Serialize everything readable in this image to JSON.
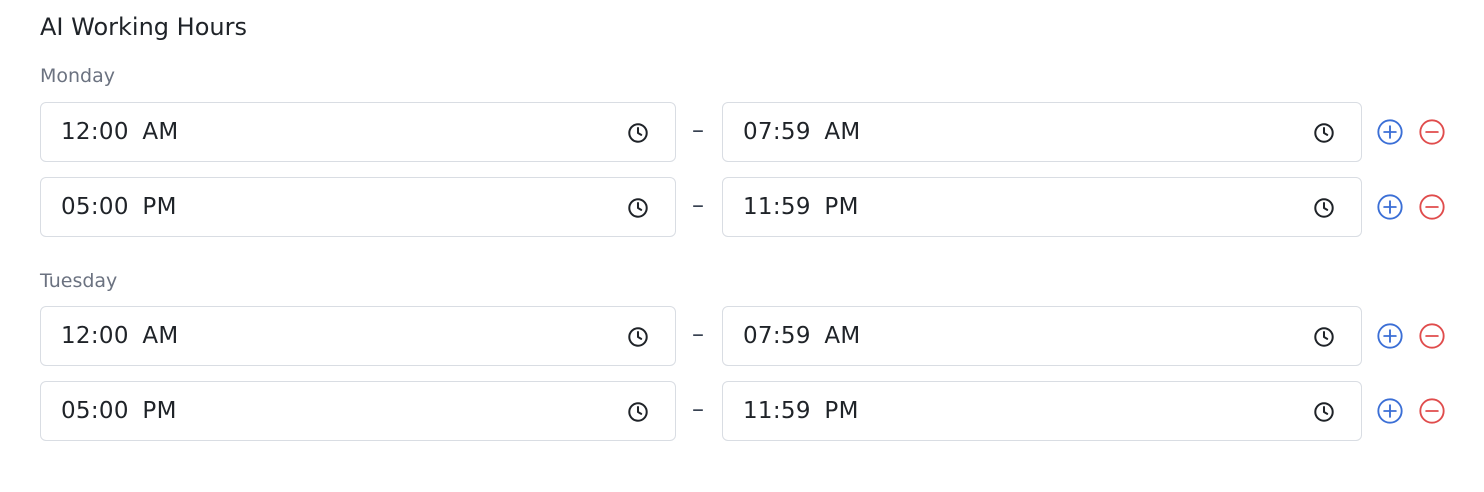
{
  "title": "AI Working Hours",
  "separator": "–",
  "colors": {
    "add": "#3b6fd6",
    "remove": "#e04c4c",
    "border": "#d9dde3",
    "label": "#6b7280"
  },
  "icons": {
    "field": "clock-icon",
    "add": "plus-circle-icon",
    "remove": "minus-circle-icon"
  },
  "days": [
    {
      "label": "Monday",
      "slots": [
        {
          "start": "12:00 AM",
          "end": "07:59 AM"
        },
        {
          "start": "05:00 PM",
          "end": "11:59 PM"
        }
      ]
    },
    {
      "label": "Tuesday",
      "slots": [
        {
          "start": "12:00 AM",
          "end": "07:59 AM"
        },
        {
          "start": "05:00 PM",
          "end": "11:59 PM"
        }
      ]
    }
  ]
}
